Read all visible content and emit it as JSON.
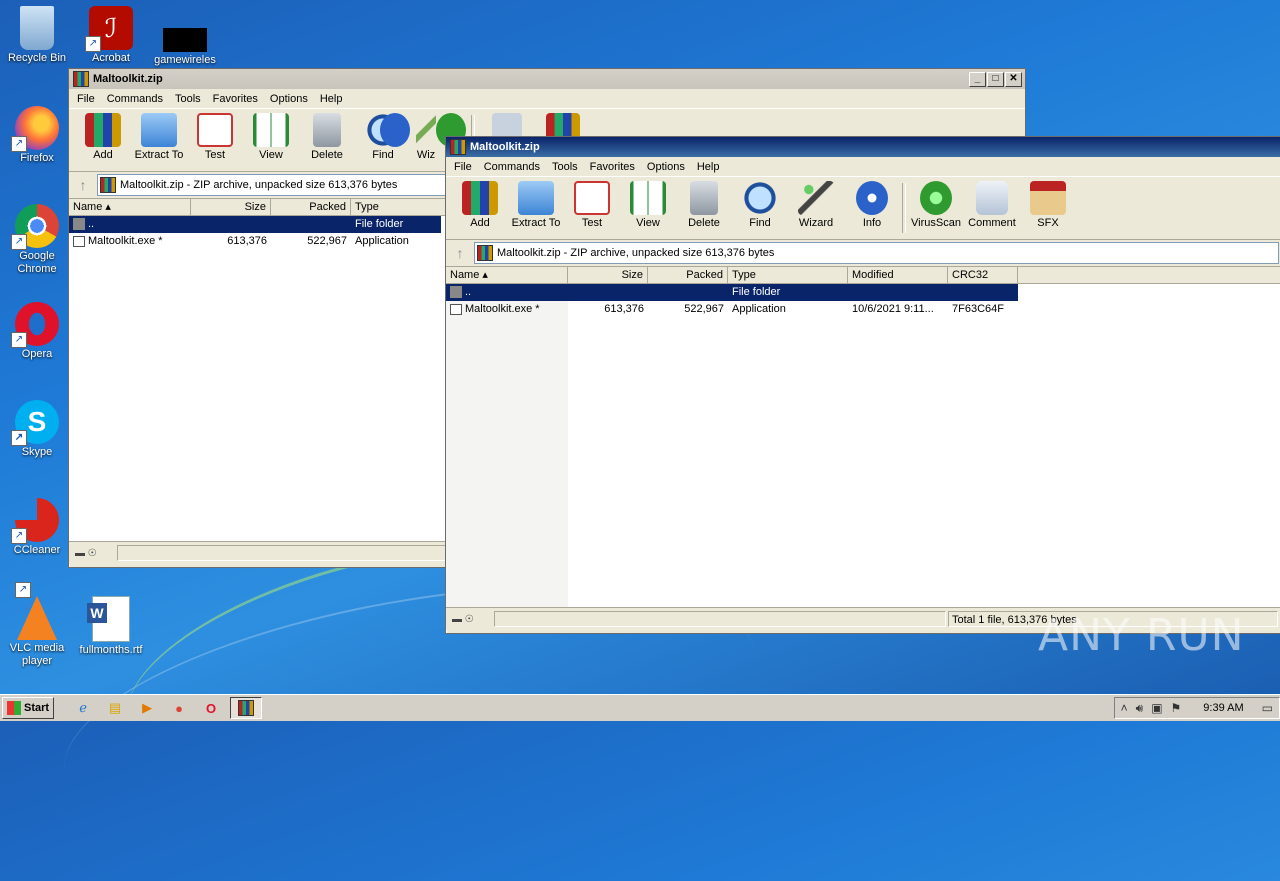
{
  "desktop": {
    "icons": [
      {
        "label": "Recycle Bin",
        "icon": "recycle-bin-icon"
      },
      {
        "label": "Acrobat",
        "icon": "acrobat-icon"
      },
      {
        "label": "gamewireles",
        "icon": "black-file-icon"
      },
      {
        "label": "Firefox",
        "icon": "firefox-icon"
      },
      {
        "label": "Google Chrome",
        "icon": "chrome-icon"
      },
      {
        "label": "Opera",
        "icon": "opera-icon"
      },
      {
        "label": "Skype",
        "icon": "skype-icon"
      },
      {
        "label": "CCleaner",
        "icon": "ccleaner-icon"
      },
      {
        "label": "VLC media player",
        "icon": "vlc-icon"
      },
      {
        "label": "fullmonths.rtf",
        "icon": "word-document-icon"
      }
    ]
  },
  "back_window": {
    "title": "Maltoolkit.zip",
    "menu": [
      "File",
      "Commands",
      "Tools",
      "Favorites",
      "Options",
      "Help"
    ],
    "toolbar": [
      "Add",
      "Extract To",
      "Test",
      "View",
      "Delete",
      "Find",
      "Wiz"
    ],
    "address": "Maltoolkit.zip - ZIP archive, unpacked size 613,376 bytes",
    "columns": [
      "Name",
      "Size",
      "Packed",
      "Type"
    ],
    "rows": [
      {
        "name": "..",
        "size": "",
        "packed": "",
        "type": "File folder"
      },
      {
        "name": "Maltoolkit.exe *",
        "size": "613,376",
        "packed": "522,967",
        "type": "Application"
      }
    ]
  },
  "front_window": {
    "title": "Maltoolkit.zip",
    "menu": [
      "File",
      "Commands",
      "Tools",
      "Favorites",
      "Options",
      "Help"
    ],
    "toolbar": [
      "Add",
      "Extract To",
      "Test",
      "View",
      "Delete",
      "Find",
      "Wizard",
      "Info",
      "VirusScan",
      "Comment",
      "SFX"
    ],
    "address": "Maltoolkit.zip - ZIP archive, unpacked size 613,376 bytes",
    "columns": [
      "Name",
      "Size",
      "Packed",
      "Type",
      "Modified",
      "CRC32"
    ],
    "rows": [
      {
        "name": "..",
        "size": "",
        "packed": "",
        "type": "File folder",
        "modified": "",
        "crc": ""
      },
      {
        "name": "Maltoolkit.exe *",
        "size": "613,376",
        "packed": "522,967",
        "type": "Application",
        "modified": "10/6/2021 9:11...",
        "crc": "7F63C64F"
      }
    ],
    "status": "Total 1 file, 613,376 bytes"
  },
  "taskbar": {
    "start_label": "Start",
    "clock": "9:39 AM"
  },
  "watermark": "ANY RUN"
}
